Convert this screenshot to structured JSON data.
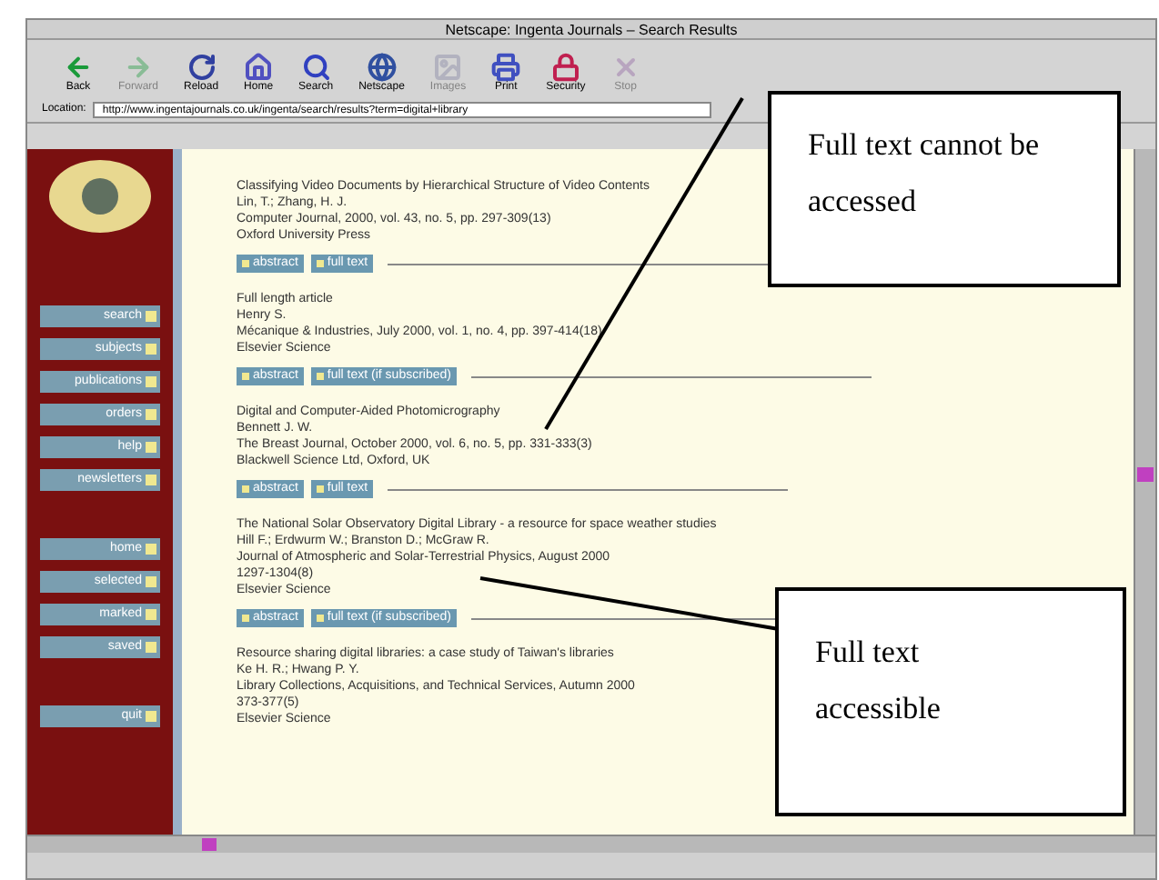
{
  "window": {
    "title": "Netscape: Ingenta Journals – Search Results"
  },
  "toolbar": [
    {
      "label": "Back",
      "disabled": false
    },
    {
      "label": "Forward",
      "disabled": true
    },
    {
      "label": "Reload",
      "disabled": false
    },
    {
      "label": "Home",
      "disabled": false
    },
    {
      "label": "Search",
      "disabled": false
    },
    {
      "label": "Netscape",
      "disabled": false
    },
    {
      "label": "Images",
      "disabled": true
    },
    {
      "label": "Print",
      "disabled": false
    },
    {
      "label": "Security",
      "disabled": false
    },
    {
      "label": "Stop",
      "disabled": true
    }
  ],
  "location": {
    "label": "Location:",
    "url": "http://www.ingentajournals.co.uk/ingenta/search/results?term=digital+library"
  },
  "sidebar": {
    "groups": [
      [
        "search",
        "subjects",
        "publications",
        "orders",
        "help",
        "newsletters"
      ],
      [
        "home",
        "selected",
        "marked",
        "saved"
      ],
      [
        "quit"
      ]
    ]
  },
  "results": [
    {
      "lines": [
        "Classifying Video Documents by Hierarchical Structure of Video Contents",
        "Lin, T.; Zhang, H. J.",
        "Computer Journal, 2000, vol. 43, no. 5, pp. 297-309(13)",
        "Oxford University Press"
      ],
      "buttons": [
        "abstract",
        "full text"
      ]
    },
    {
      "lines": [
        "Full length article",
        "Henry S.",
        "Mécanique & Industries, July 2000, vol. 1, no. 4, pp. 397-414(18)",
        "Elsevier Science"
      ],
      "buttons": [
        "abstract",
        "full text (if subscribed)"
      ]
    },
    {
      "lines": [
        "Digital and Computer-Aided Photomicrography",
        "Bennett J. W.",
        "The Breast Journal, October 2000, vol. 6, no. 5, pp. 331-333(3)",
        "Blackwell Science Ltd, Oxford, UK"
      ],
      "buttons": [
        "abstract",
        "full text"
      ]
    },
    {
      "lines": [
        "The National Solar Observatory Digital Library - a resource for space weather studies",
        "Hill F.; Erdwurm W.; Branston D.; McGraw R.",
        "Journal of Atmospheric and Solar-Terrestrial Physics, August 2000",
        "1297-1304(8)",
        "Elsevier Science"
      ],
      "buttons": [
        "abstract",
        "full text (if subscribed)"
      ]
    },
    {
      "lines": [
        "Resource sharing digital libraries: a case study of Taiwan's libraries",
        "Ke H. R.; Hwang P. Y.",
        "Library Collections, Acquisitions, and Technical Services, Autumn 2000",
        "373-377(5)",
        "Elsevier Science"
      ]
    }
  ],
  "callouts": [
    {
      "text": "Full text cannot be accessed"
    },
    {
      "text": "Full text accessible"
    }
  ]
}
